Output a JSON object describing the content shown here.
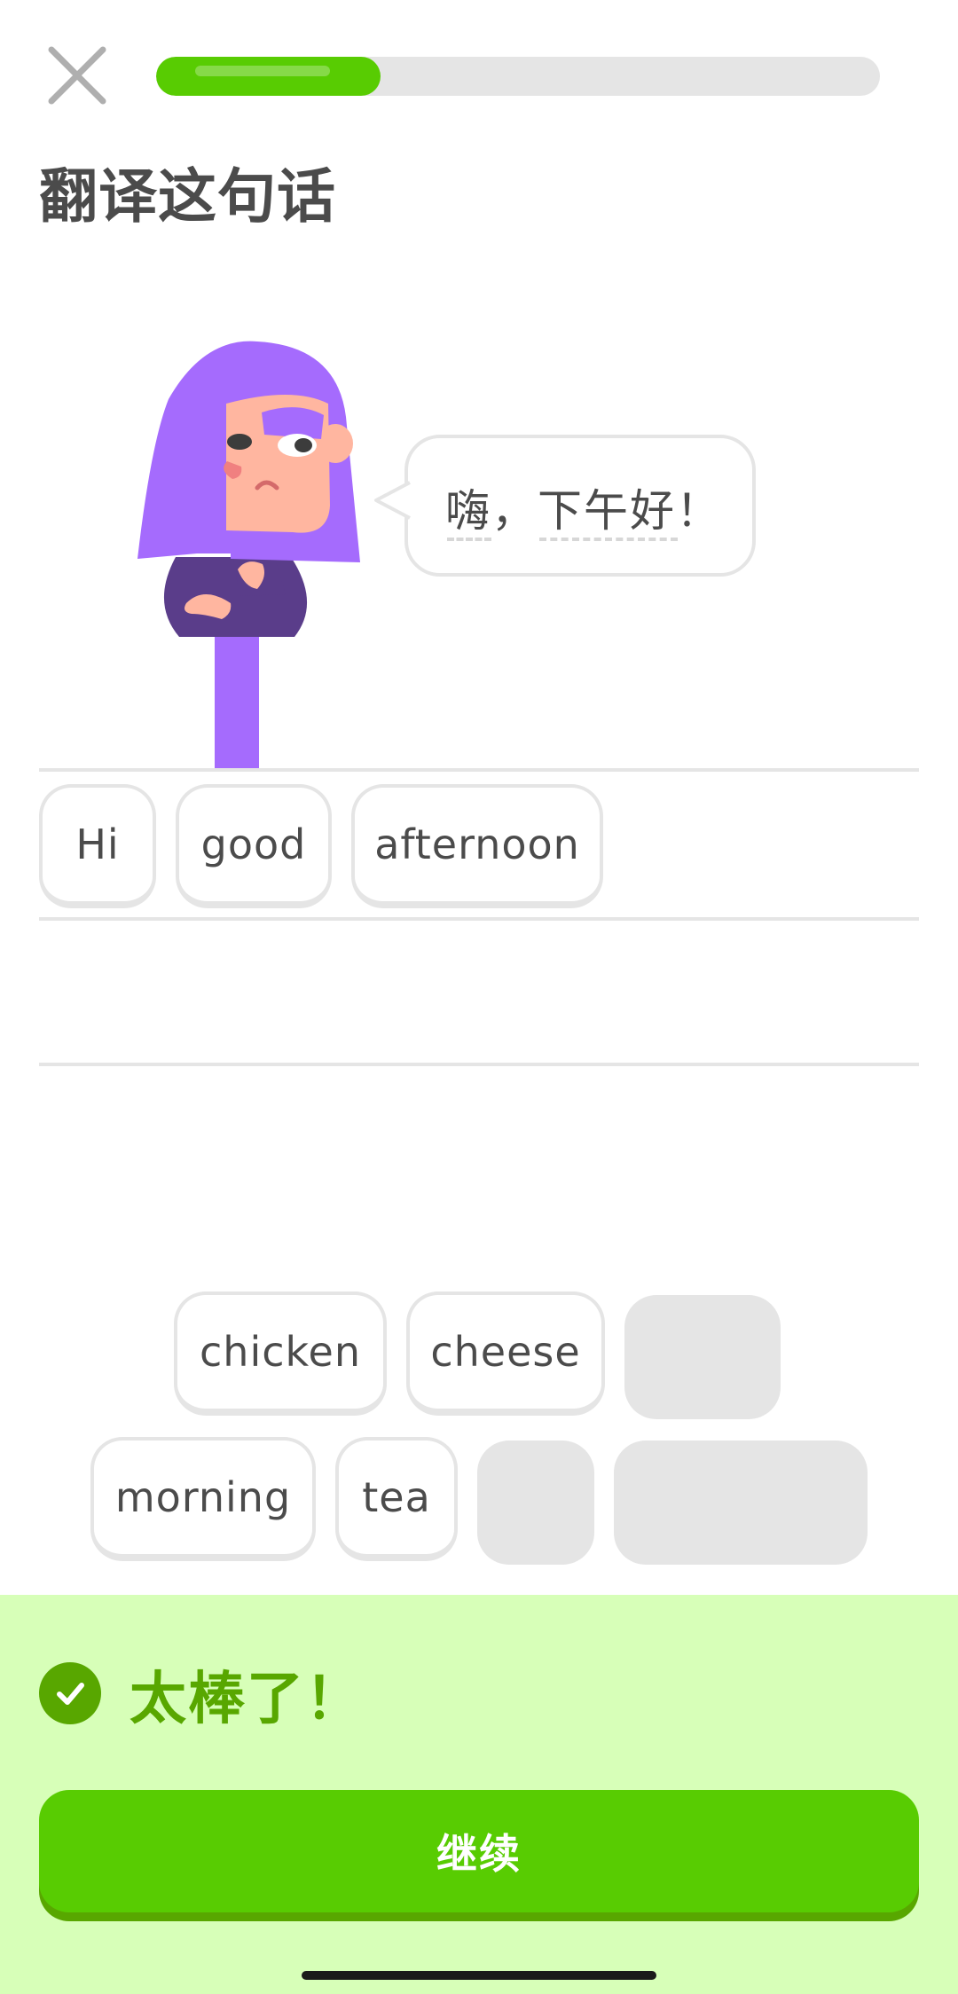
{
  "colors": {
    "progress_green": "#58cc02",
    "feedback_bg": "#d7ffb8",
    "feedback_text": "#58a700",
    "button_green": "#58cc02",
    "button_shadow": "#58a700",
    "character_hair": "#a56bfd"
  },
  "header": {
    "close_icon": "close-icon",
    "progress": 0.31
  },
  "prompt": {
    "title": "翻译这句话"
  },
  "speech": {
    "text": "嗨，下午好！"
  },
  "answer": {
    "selected_words": [
      "Hi",
      "good",
      "afternoon"
    ]
  },
  "word_bank": {
    "row1": [
      "chicken",
      "cheese"
    ],
    "row2": [
      "morning",
      "tea"
    ]
  },
  "feedback": {
    "icon": "check-circle-icon",
    "title": "太棒了！",
    "continue_label": "继续"
  }
}
